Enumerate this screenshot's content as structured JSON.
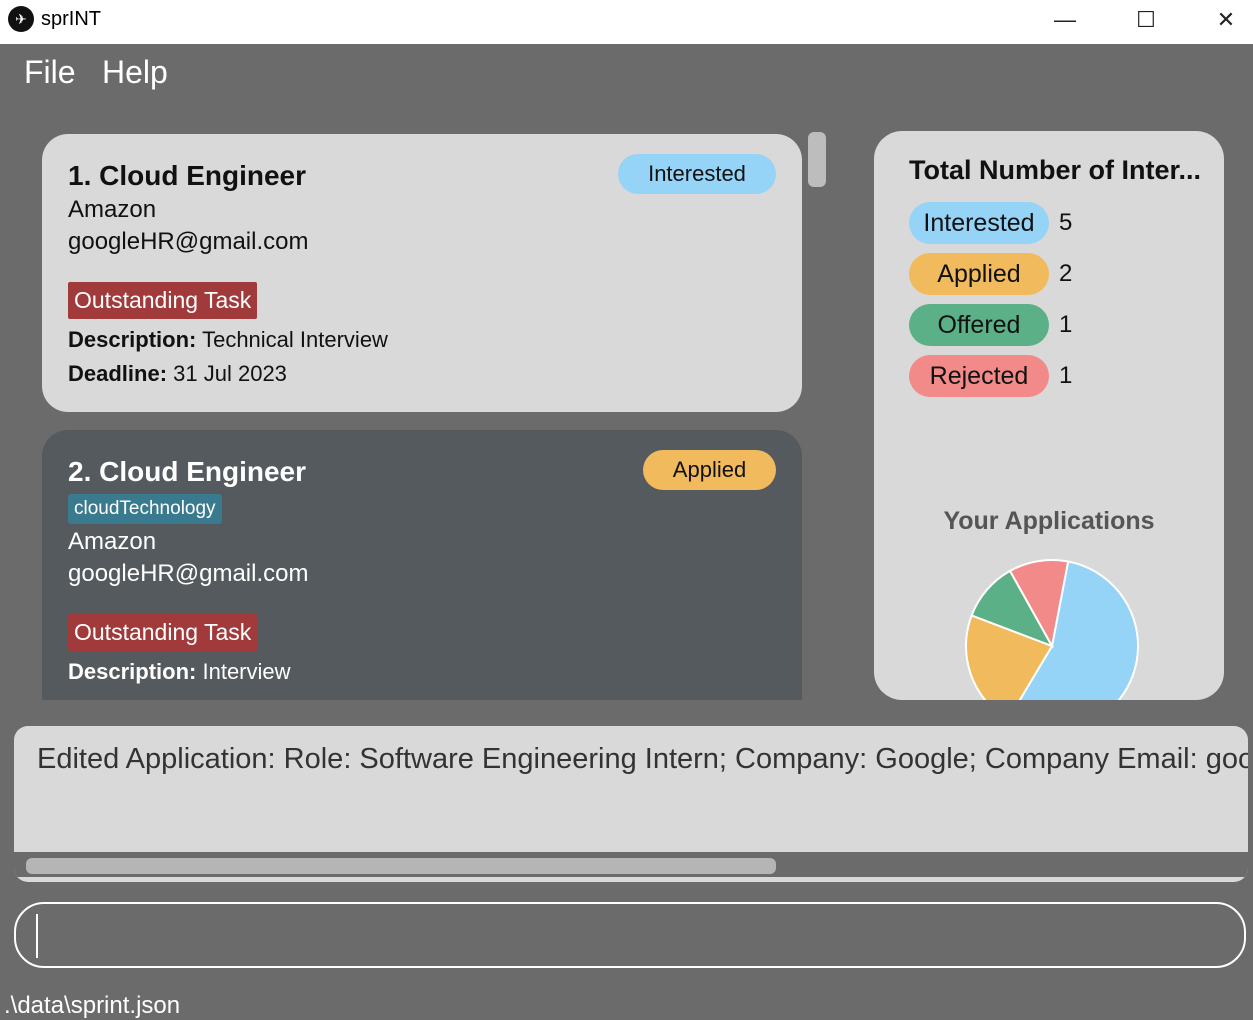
{
  "window": {
    "title": "sprINT",
    "minimize": "—",
    "maximize": "☐",
    "close": "✕"
  },
  "menu": {
    "file": "File",
    "help": "Help"
  },
  "applications": [
    {
      "title": "1.  Cloud Engineer",
      "status": "Interested",
      "company": "Amazon",
      "email": "googleHR@gmail.com",
      "task_label": "Outstanding Task",
      "description_label": "Description:",
      "description": "Technical Interview",
      "deadline_label": "Deadline:",
      "deadline": "31 Jul 2023"
    },
    {
      "title": "2.  Cloud Engineer",
      "status": "Applied",
      "tag": "cloudTechnology",
      "company": "Amazon",
      "email": "googleHR@gmail.com",
      "task_label": "Outstanding Task",
      "description_label": "Description:",
      "description": "Interview"
    }
  ],
  "stats": {
    "title": "Total Number of Inter...",
    "rows": [
      {
        "label": "Interested",
        "count": "5",
        "color": "#95d3f7"
      },
      {
        "label": "Applied",
        "count": "2",
        "color": "#f1ba5c"
      },
      {
        "label": "Offered",
        "count": "1",
        "color": "#5bb088"
      },
      {
        "label": "Rejected",
        "count": "1",
        "color": "#f28a8a"
      }
    ],
    "chart_title": "Your Applications"
  },
  "chart_data": {
    "type": "pie",
    "title": "Your Applications",
    "labels": [
      "Interested",
      "Applied",
      "Offered",
      "Rejected"
    ],
    "values": [
      5,
      2,
      1,
      1
    ],
    "colors": [
      "#95d3f7",
      "#f1ba5c",
      "#5bb088",
      "#f28a8a"
    ]
  },
  "result": {
    "text": "Edited Application: Role: Software Engineering Intern; Company: Google; Company Email: goog"
  },
  "command": {
    "value": ""
  },
  "status_bar": {
    "path": ".\\data\\sprint.json"
  }
}
